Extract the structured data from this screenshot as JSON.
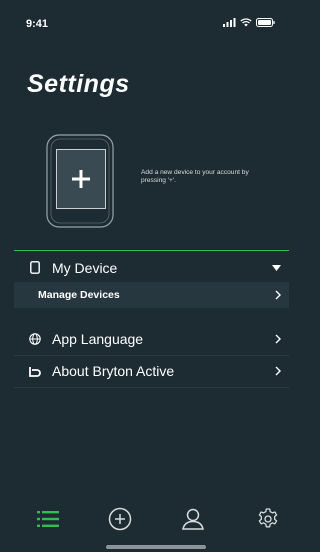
{
  "status_bar": {
    "time": "9:41"
  },
  "header": {
    "title": "Settings"
  },
  "device_prompt": {
    "hint": "Add a new device to your account by pressing '+'."
  },
  "menu": {
    "my_device": "My Device",
    "manage_devices": "Manage Devices",
    "app_language": "App Language",
    "about": "About Bryton Active"
  },
  "colors": {
    "background": "#1d2b33",
    "accent_green": "#2fbf4f",
    "submenu_bg": "#27373f"
  },
  "tab_bar": {
    "tabs": [
      "list-icon",
      "add-circle-icon",
      "user-icon",
      "settings-gear-icon"
    ],
    "active": "list-icon"
  }
}
